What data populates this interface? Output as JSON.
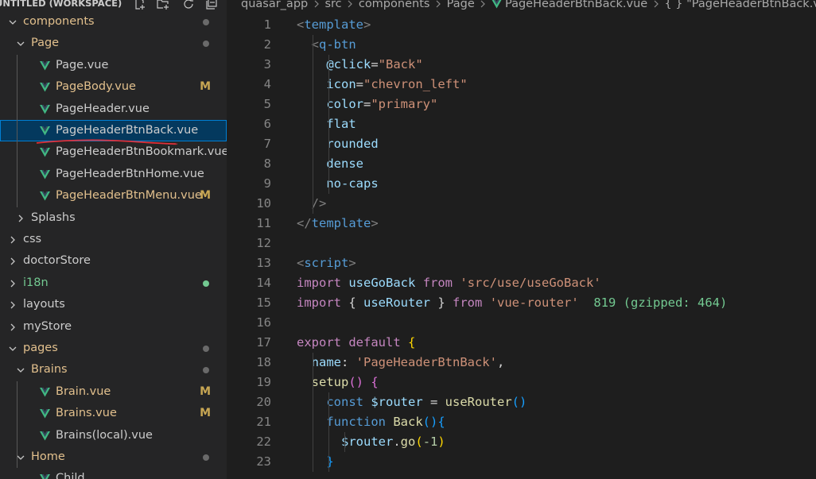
{
  "sidebar": {
    "workspace_title": "UNTITLED (WORKSPACE)",
    "header_icons": [
      "new-file-icon",
      "new-folder-icon",
      "refresh-icon",
      "collapse-all-icon"
    ],
    "items": [
      {
        "label": "components",
        "type": "folder",
        "open": true,
        "status": "dot"
      },
      {
        "label": "Page",
        "type": "folder",
        "open": true,
        "status": "dot"
      },
      {
        "label": "Page.vue",
        "type": "vue"
      },
      {
        "label": "PageBody.vue",
        "type": "vue",
        "status": "M"
      },
      {
        "label": "PageHeader.vue",
        "type": "vue"
      },
      {
        "label": "PageHeaderBtnBack.vue",
        "type": "vue",
        "selected": true
      },
      {
        "label": "PageHeaderBtnBookmark.vue",
        "type": "vue"
      },
      {
        "label": "PageHeaderBtnHome.vue",
        "type": "vue"
      },
      {
        "label": "PageHeaderBtnMenu.vue",
        "type": "vue",
        "status": "M"
      },
      {
        "label": "Splashs",
        "type": "folder",
        "open": false
      },
      {
        "label": "css",
        "type": "folder",
        "open": false
      },
      {
        "label": "doctorStore",
        "type": "folder",
        "open": false
      },
      {
        "label": "i18n",
        "type": "folder",
        "open": false,
        "status": "green-dot"
      },
      {
        "label": "layouts",
        "type": "folder",
        "open": false
      },
      {
        "label": "myStore",
        "type": "folder",
        "open": false
      },
      {
        "label": "pages",
        "type": "folder",
        "open": true,
        "status": "dot"
      },
      {
        "label": "Brains",
        "type": "folder",
        "open": true,
        "status": "dot"
      },
      {
        "label": "Brain.vue",
        "type": "vue",
        "status": "M"
      },
      {
        "label": "Brains.vue",
        "type": "vue",
        "status": "M"
      },
      {
        "label": "Brains(local).vue",
        "type": "vue"
      },
      {
        "label": "Home",
        "type": "folder",
        "open": true,
        "status": "dot"
      },
      {
        "label": "Child",
        "type": "vue"
      }
    ]
  },
  "breadcrumb": [
    "quasar_app",
    "src",
    "components",
    "Page",
    "PageHeaderBtnBack.vue",
    "{ } \"PageHeaderBtnBack.vue\""
  ],
  "editor": {
    "lines": [
      {
        "n": "1",
        "code": [
          [
            "tk-punc",
            "<"
          ],
          [
            "tk-tag",
            "template"
          ],
          [
            "tk-punc",
            ">"
          ]
        ]
      },
      {
        "n": "2",
        "code": [
          [
            "tk-plain",
            "  "
          ],
          [
            "tk-punc",
            "<"
          ],
          [
            "tk-tag",
            "q-btn"
          ]
        ]
      },
      {
        "n": "3",
        "code": [
          [
            "tk-plain",
            "    "
          ],
          [
            "tk-attr",
            "@click"
          ],
          [
            "tk-plain",
            "="
          ],
          [
            "tk-str",
            "\"Back\""
          ]
        ]
      },
      {
        "n": "4",
        "code": [
          [
            "tk-plain",
            "    "
          ],
          [
            "tk-attr",
            "icon"
          ],
          [
            "tk-plain",
            "="
          ],
          [
            "tk-str",
            "\"chevron_left\""
          ]
        ]
      },
      {
        "n": "5",
        "code": [
          [
            "tk-plain",
            "    "
          ],
          [
            "tk-attr",
            "color"
          ],
          [
            "tk-plain",
            "="
          ],
          [
            "tk-str",
            "\"primary\""
          ]
        ]
      },
      {
        "n": "6",
        "code": [
          [
            "tk-plain",
            "    "
          ],
          [
            "tk-attr",
            "flat"
          ]
        ]
      },
      {
        "n": "7",
        "code": [
          [
            "tk-plain",
            "    "
          ],
          [
            "tk-attr",
            "rounded"
          ]
        ]
      },
      {
        "n": "8",
        "code": [
          [
            "tk-plain",
            "    "
          ],
          [
            "tk-attr",
            "dense"
          ]
        ]
      },
      {
        "n": "9",
        "code": [
          [
            "tk-plain",
            "    "
          ],
          [
            "tk-attr",
            "no-caps"
          ]
        ]
      },
      {
        "n": "10",
        "code": [
          [
            "tk-plain",
            "  "
          ],
          [
            "tk-punc",
            "/>"
          ]
        ]
      },
      {
        "n": "11",
        "code": [
          [
            "tk-punc",
            "</"
          ],
          [
            "tk-tag",
            "template"
          ],
          [
            "tk-punc",
            ">"
          ]
        ]
      },
      {
        "n": "12",
        "code": []
      },
      {
        "n": "13",
        "code": [
          [
            "tk-punc",
            "<"
          ],
          [
            "tk-tag",
            "script"
          ],
          [
            "tk-punc",
            ">"
          ]
        ]
      },
      {
        "n": "14",
        "code": [
          [
            "tk-kw",
            "import"
          ],
          [
            "tk-plain",
            " "
          ],
          [
            "tk-var",
            "useGoBack"
          ],
          [
            "tk-plain",
            " "
          ],
          [
            "tk-kw",
            "from"
          ],
          [
            "tk-plain",
            " "
          ],
          [
            "tk-str",
            "'src/use/useGoBack'"
          ]
        ]
      },
      {
        "n": "15",
        "code": [
          [
            "tk-kw",
            "import"
          ],
          [
            "tk-plain",
            " "
          ],
          [
            "tk-plain",
            "{ "
          ],
          [
            "tk-var",
            "useRouter"
          ],
          [
            "tk-plain",
            " } "
          ],
          [
            "tk-kw",
            "from"
          ],
          [
            "tk-plain",
            " "
          ],
          [
            "tk-str",
            "'vue-router'"
          ],
          [
            "tk-plain",
            "  "
          ],
          [
            "tk-hint",
            "819 (gzipped: 464)"
          ]
        ]
      },
      {
        "n": "16",
        "code": []
      },
      {
        "n": "17",
        "code": [
          [
            "tk-kw",
            "export"
          ],
          [
            "tk-plain",
            " "
          ],
          [
            "tk-kw",
            "default"
          ],
          [
            "tk-plain",
            " "
          ],
          [
            "tk-brace",
            "{"
          ]
        ]
      },
      {
        "n": "18",
        "code": [
          [
            "tk-plain",
            "  "
          ],
          [
            "tk-var",
            "name"
          ],
          [
            "tk-plain",
            ": "
          ],
          [
            "tk-str",
            "'PageHeaderBtnBack'"
          ],
          [
            "tk-plain",
            ","
          ]
        ]
      },
      {
        "n": "19",
        "code": [
          [
            "tk-plain",
            "  "
          ],
          [
            "tk-fn",
            "setup"
          ],
          [
            "tk-brace2",
            "()"
          ],
          [
            "tk-plain",
            " "
          ],
          [
            "tk-brace2",
            "{"
          ]
        ]
      },
      {
        "n": "20",
        "code": [
          [
            "tk-plain",
            "    "
          ],
          [
            "tk-kw2",
            "const"
          ],
          [
            "tk-plain",
            " "
          ],
          [
            "tk-var",
            "$router"
          ],
          [
            "tk-plain",
            " = "
          ],
          [
            "tk-fn",
            "useRouter"
          ],
          [
            "tk-brace3",
            "()"
          ]
        ]
      },
      {
        "n": "21",
        "code": [
          [
            "tk-plain",
            "    "
          ],
          [
            "tk-kw2",
            "function"
          ],
          [
            "tk-plain",
            " "
          ],
          [
            "tk-fn",
            "Back"
          ],
          [
            "tk-brace3",
            "()"
          ],
          [
            "tk-brace3",
            "{"
          ]
        ]
      },
      {
        "n": "22",
        "code": [
          [
            "tk-plain",
            "      "
          ],
          [
            "tk-var",
            "$router"
          ],
          [
            "tk-plain",
            "."
          ],
          [
            "tk-fn",
            "go"
          ],
          [
            "tk-brace",
            "("
          ],
          [
            "tk-num",
            "-1"
          ],
          [
            "tk-brace",
            ")"
          ]
        ]
      },
      {
        "n": "23",
        "code": [
          [
            "tk-plain",
            "    "
          ],
          [
            "tk-brace3",
            "}"
          ]
        ]
      }
    ]
  },
  "colors": {
    "editor_bg": "#1e1e1e",
    "sidebar_bg": "#252526",
    "selection": "#04395e",
    "selection_border": "#007fd4",
    "modified": "#e2c08d",
    "untracked": "#73c991",
    "vue_icon": "#41b883"
  }
}
